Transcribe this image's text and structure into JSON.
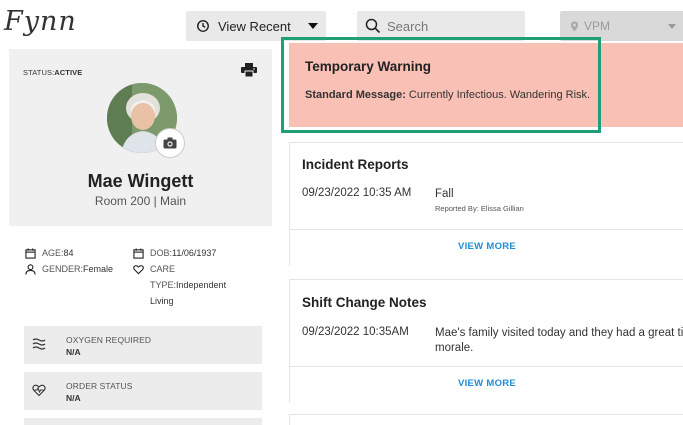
{
  "header": {
    "logo": "Fynn",
    "view_recent_label": "View Recent",
    "search_placeholder": "Search",
    "location_label": "VPM"
  },
  "profile": {
    "status_label": "STATUS:",
    "status_value": "ACTIVE",
    "name": "Mae Wingett",
    "room": "Room 200 | Main",
    "age_label": "AGE:",
    "age_value": "84",
    "dob_label": "DOB:",
    "dob_value": "11/06/1937",
    "gender_label": "GENDER:",
    "gender_value": "Female",
    "care_label": "CARE",
    "care_type_label": "TYPE:",
    "care_type_value_line1": "Independent",
    "care_type_value_line2": "Living"
  },
  "stats": [
    {
      "label": "OXYGEN REQUIRED",
      "value": "N/A",
      "icon": "wind-icon"
    },
    {
      "label": "ORDER STATUS",
      "value": "N/A",
      "icon": "heartbeat-icon"
    }
  ],
  "warning": {
    "title": "Temporary Warning",
    "message_label": "Standard Message:",
    "message_text": " Currently Infectious. Wandering Risk.",
    "background": "#f9c0b5",
    "highlight_color": "#1f9e78"
  },
  "incident_reports": {
    "title": "Incident Reports",
    "date": "09/23/2022 10:35 AM",
    "entry": "Fall",
    "reported_by": "Reported By: Elissa Gillian",
    "view_more": "VIEW MORE"
  },
  "shift_notes": {
    "title": "Shift Change Notes",
    "date": "09/23/2022 10:35AM",
    "entry_line1": "Mae's family visited today and they had a great tim",
    "entry_line2": "morale.",
    "view_more": "VIEW MORE"
  },
  "colors": {
    "accent_link": "#1e8fd6",
    "panel_bg": "#f0f0f0"
  }
}
